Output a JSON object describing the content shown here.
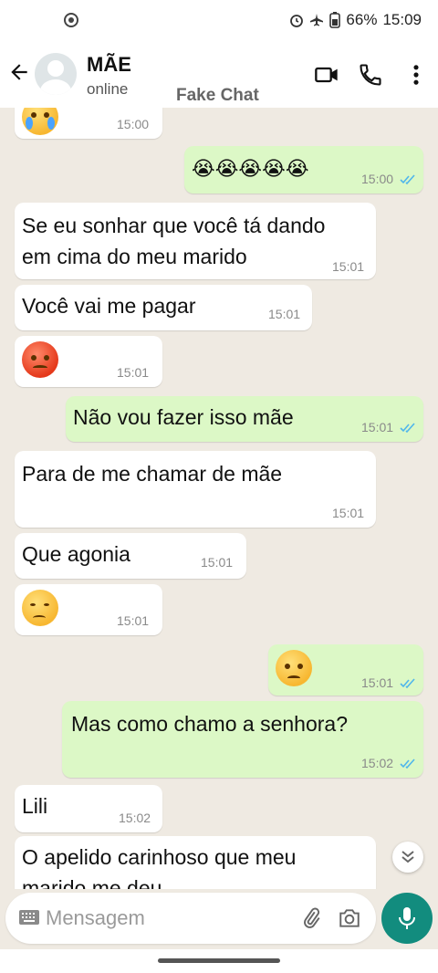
{
  "status_bar": {
    "battery": "66%",
    "time": "15:09"
  },
  "header": {
    "contact_name": "MÃE",
    "contact_status": "online",
    "watermark": "Fake Chat",
    "icons": [
      "back-arrow-icon",
      "video-call-icon",
      "phone-icon",
      "more-options-icon"
    ]
  },
  "messages": [
    {
      "dir": "in",
      "text": "",
      "emoji": "crying-face",
      "time": "15:00"
    },
    {
      "dir": "out",
      "text": "😭😭😭😭😭",
      "time": "15:00",
      "read": true
    },
    {
      "dir": "in",
      "text": " Se eu sonhar que você tá dando\nem cima do meu marido",
      "time": "15:01"
    },
    {
      "dir": "in",
      "text": "Você vai me pagar",
      "time": "15:01"
    },
    {
      "dir": "in",
      "text": "",
      "emoji": "angry-face",
      "time": "15:01"
    },
    {
      "dir": "out",
      "text": "Não vou fazer isso mãe",
      "time": "15:01",
      "read": true
    },
    {
      "dir": "in",
      "text": "Para de me chamar de mãe",
      "time": "15:01"
    },
    {
      "dir": "in",
      "text": "Que agonia",
      "time": "15:01"
    },
    {
      "dir": "in",
      "text": "",
      "emoji": "unamused-face",
      "time": "15:01"
    },
    {
      "dir": "out",
      "text": "",
      "emoji": "worried-face",
      "time": "15:01",
      "read": true
    },
    {
      "dir": "out",
      "text": "Mas como chamo a senhora?",
      "time": "15:02",
      "read": true
    },
    {
      "dir": "in",
      "text": " Lili",
      "time": "15:02"
    },
    {
      "dir": "in",
      "text": "O apelido carinhoso que meu\nmarido me deu",
      "time": ""
    }
  ],
  "composer": {
    "placeholder": "Mensagem"
  },
  "colors": {
    "background": "#efeae2",
    "incoming": "#ffffff",
    "outgoing": "#dcf8c6",
    "accent": "#128c7e",
    "read_ticks": "#4fb6ec"
  }
}
